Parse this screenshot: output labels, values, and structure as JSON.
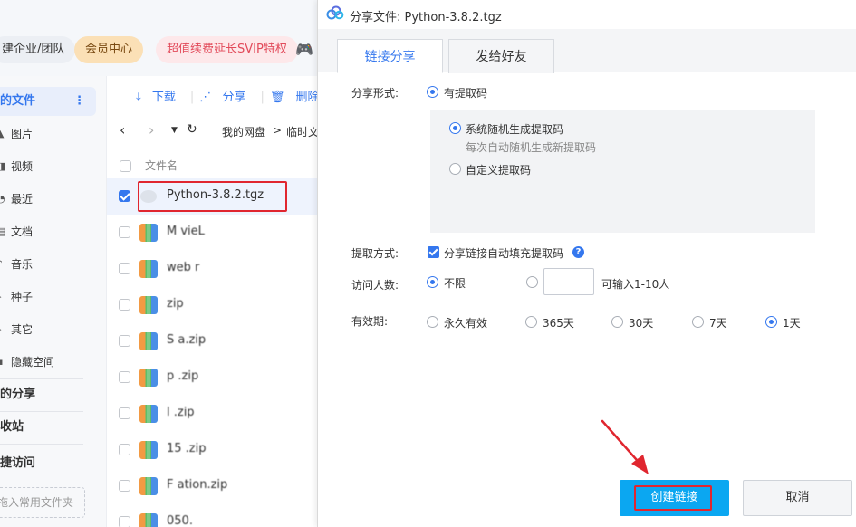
{
  "topbar": {
    "team_label": "建企业/团队",
    "vip_label": "会员中心",
    "promo_label": "超值续费延长SVIP特权"
  },
  "sidebar": {
    "my_files": "的文件",
    "items": [
      {
        "icon": "image-icon",
        "label": "图片"
      },
      {
        "icon": "video-icon",
        "label": "视频"
      },
      {
        "icon": "clock-icon",
        "label": "最近"
      },
      {
        "icon": "doc-icon",
        "label": "文档"
      },
      {
        "icon": "music-icon",
        "label": "音乐"
      },
      {
        "icon": "seed-icon",
        "label": "种子"
      },
      {
        "icon": "other-icon",
        "label": "其它"
      },
      {
        "icon": "lock-icon",
        "label": "隐藏空间"
      }
    ],
    "my_share": "的分享",
    "recycle": "收站",
    "quick_access": "捷访问",
    "drop_hint": "拖入常用文件夹"
  },
  "file_toolbar": {
    "download": "下载",
    "share": "分享",
    "delete": "删除"
  },
  "nav": {
    "path_root": "我的网盘",
    "path_sep": ">",
    "path_current": "临时文"
  },
  "file_list": {
    "column_name": "文件名",
    "files": [
      {
        "name": "Python-3.8.2.tgz",
        "type": "tgz",
        "checked": true
      },
      {
        "name": "M vieL",
        "type": "zip",
        "checked": false
      },
      {
        "name": "web r",
        "type": "zip",
        "checked": false
      },
      {
        "name": "zip",
        "type": "zip",
        "checked": false
      },
      {
        "name": "S a.zip",
        "type": "zip",
        "checked": false
      },
      {
        "name": "p .zip",
        "type": "zip",
        "checked": false
      },
      {
        "name": "l .zip",
        "type": "zip",
        "checked": false
      },
      {
        "name": "15 .zip",
        "type": "zip",
        "checked": false
      },
      {
        "name": "F ation.zip",
        "type": "zip",
        "checked": false
      },
      {
        "name": "050.",
        "type": "zip",
        "checked": false
      }
    ]
  },
  "dialog": {
    "title": "分享文件: Python-3.8.2.tgz",
    "tabs": [
      "链接分享",
      "发给好友"
    ],
    "share_form_label": "分享形式:",
    "with_code": "有提取码",
    "random_code": "系统随机生成提取码",
    "random_hint": "每次自动随机生成新提取码",
    "custom_code": "自定义提取码",
    "extract_method_label": "提取方式:",
    "auto_fill": "分享链接自动填充提取码",
    "visitors_label": "访问人数:",
    "unlimited": "不限",
    "visitors_hint": "可输入1-10人",
    "validity_label": "有效期:",
    "validity_options": [
      "永久有效",
      "365天",
      "30天",
      "7天",
      "1天"
    ],
    "validity_selected": "1天",
    "create_button": "创建链接",
    "cancel_button": "取消"
  },
  "colors": {
    "accent": "#3477ee",
    "create_button": "#0ba7f1",
    "highlight_red": "#e0262f"
  }
}
